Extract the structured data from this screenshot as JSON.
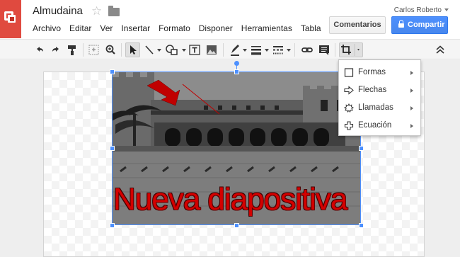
{
  "header": {
    "doc_title": "Almudaina",
    "user_name": "Carlos Roberto",
    "comments_label": "Comentarios",
    "share_label": "Compartir"
  },
  "menu": {
    "items": [
      "Archivo",
      "Editar",
      "Ver",
      "Insertar",
      "Formato",
      "Disponer",
      "Herramientas",
      "Tabla"
    ]
  },
  "toolbar": {
    "icons": [
      "undo-icon",
      "redo-icon",
      "paint-format-icon",
      "new-slide-icon",
      "zoom-icon",
      "select-icon",
      "line-icon",
      "shape-icon",
      "text-box-icon",
      "image-icon",
      "pen-icon",
      "line-weight-icon",
      "line-dash-icon",
      "link-icon",
      "comment-icon",
      "crop-icon",
      "collapse-icon"
    ]
  },
  "slide": {
    "text": "Nueva diapositiva",
    "text_color": "#d40000"
  },
  "dropdown": {
    "items": [
      "Formas",
      "Flechas",
      "Llamadas",
      "Ecuación"
    ]
  },
  "colors": {
    "accent": "#4d90fe",
    "logo": "#e04a3f"
  }
}
